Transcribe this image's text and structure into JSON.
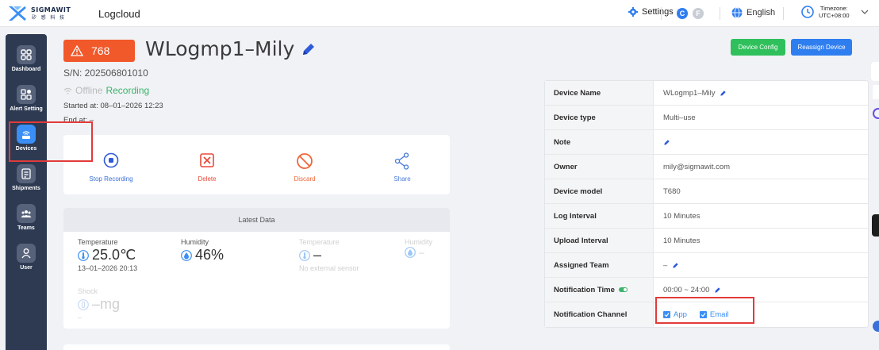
{
  "header": {
    "logo_text": "SIGMAWIT",
    "logo_subtext": "矽 感 科 技",
    "app_name": "Logcloud",
    "settings_label": "Settings",
    "user_badge_c": "C",
    "user_badge_f": "F",
    "language": "English",
    "timezone_label": "Timezone:",
    "timezone_value": "UTC+08:00"
  },
  "sidebar": {
    "items": [
      {
        "label": "Dashboard",
        "icon": "dashboard-icon",
        "active": false
      },
      {
        "label": "Alert Setting",
        "icon": "alert-setting-icon",
        "active": false
      },
      {
        "label": "Devices",
        "icon": "devices-icon",
        "active": true
      },
      {
        "label": "Shipments",
        "icon": "shipments-icon",
        "active": false
      },
      {
        "label": "Teams",
        "icon": "teams-icon",
        "active": false
      },
      {
        "label": "User",
        "icon": "user-icon",
        "active": false
      }
    ]
  },
  "device": {
    "alarm_count": "768",
    "name": "WLogmp1–Mily",
    "serial": "S/N: 202506801010",
    "status_offline": "Offline",
    "status_recording": "Recording",
    "started_at": "Started at: 08–01–2026 12:23",
    "end_at": "End at: –"
  },
  "actions": {
    "stop_recording": "Stop Recording",
    "delete": "Delete",
    "discard": "Discard",
    "share": "Share"
  },
  "latest": {
    "title": "Latest Data",
    "temperature_label": "Temperature",
    "temperature_value": "25.0℃",
    "temperature_time": "13–01–2026 20:13",
    "humidity_label": "Humidity",
    "humidity_value": "46%",
    "ext_temperature_label": "Temperature",
    "ext_temperature_value": "–",
    "ext_temperature_note": "No external sensor",
    "ext_humidity_label": "Humidity",
    "ext_humidity_value": "–",
    "shock_label": "Shock",
    "shock_value": "–mg",
    "shock_time": "–"
  },
  "buttons": {
    "device_config": "Device Config",
    "reassign_device": "Reassign Device"
  },
  "info": [
    {
      "key": "Device Name",
      "value": "WLogmp1–Mily"
    },
    {
      "key": "Device type",
      "value": "Multi–use"
    },
    {
      "key": "Note",
      "value": ""
    },
    {
      "key": "Owner",
      "value": "mily@sigmawit.com"
    },
    {
      "key": "Device model",
      "value": "T680"
    },
    {
      "key": "Log Interval",
      "value": "10 Minutes"
    },
    {
      "key": "Upload Interval",
      "value": "10 Minutes"
    },
    {
      "key": "Assigned Team",
      "value": "–"
    },
    {
      "key": "Notification Time",
      "value": "00:00 ~ 24:00"
    },
    {
      "key": "Notification Channel",
      "value": ""
    }
  ],
  "notification_channels": {
    "app": "App",
    "email": "Email"
  },
  "colors": {
    "accent_blue": "#3a8ef6",
    "alarm_orange": "#f1582a",
    "green": "#2fc05c",
    "sidebar_bg": "#2d3a52",
    "highlight_red": "#e23a3a"
  }
}
